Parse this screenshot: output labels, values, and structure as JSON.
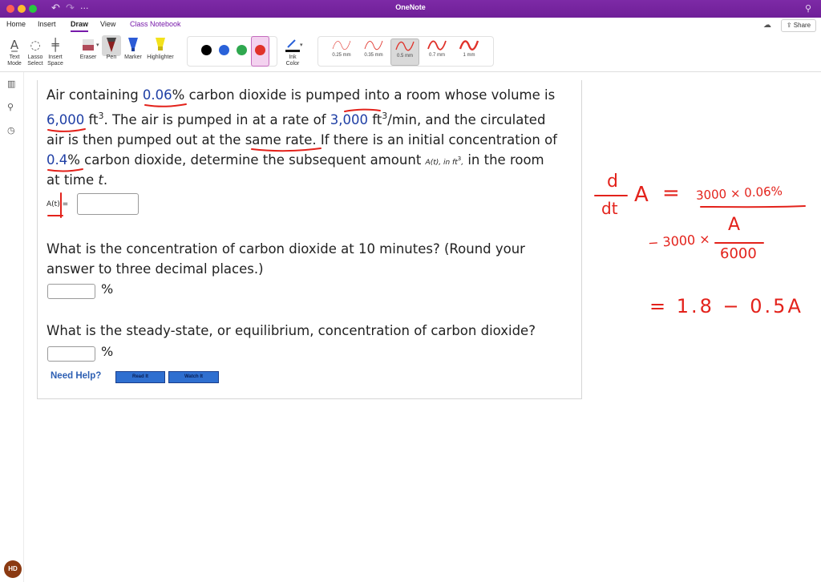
{
  "window": {
    "title": "OneNote"
  },
  "tabs": [
    {
      "label": "Home"
    },
    {
      "label": "Insert"
    },
    {
      "label": "Draw"
    },
    {
      "label": "View"
    },
    {
      "label": "Class Notebook"
    }
  ],
  "share_label": "Share",
  "ribbon": {
    "text_mode": "Text\nMode",
    "lasso_select": "Lasso\nSelect",
    "insert_space": "Insert\nSpace",
    "eraser": "Eraser",
    "pen": "Pen",
    "marker": "Marker",
    "highlighter": "Highlighter",
    "ink_color": "Ink\nColor",
    "colors": [
      "#000000",
      "#2a62d9",
      "#2fa84f",
      "#e0322a"
    ],
    "thicknesses": [
      "0.25 mm",
      "0.35 mm",
      "0.5 mm",
      "0.7 mm",
      "1 mm"
    ],
    "selected_thickness": "0.5 mm"
  },
  "problem": {
    "line1_a": "Air containing ",
    "line1_b": "0.06",
    "line1_c": "% carbon dioxide is pumped into a room whose volume is",
    "line2_a": "6,000",
    "line2_b": " ft",
    "line2_exp": "3",
    "line2_c": ". The air is pumped in at a rate of ",
    "line2_d": "3,000",
    "line2_e": " ft",
    "line2_f": "/min, and the circulated",
    "line3": "air is then pumped out at the same rate. If there is an initial concentration of",
    "line4_a": "0.4",
    "line4_b": "% carbon dioxide, determine the subsequent amount ",
    "line4_math": "A(t), in ft",
    "line4_math_end": ",",
    "line4_c": " in the room",
    "line5_a": "at time ",
    "line5_b": "t",
    "line5_c": ".",
    "at_label": "A(t) =",
    "q2_line1": "What is the concentration of carbon dioxide at 10 minutes? (Round your",
    "q2_line2": "answer to three decimal places.)",
    "q3": "What is the steady-state, or equilibrium, concentration of carbon dioxide?",
    "percent": "%",
    "need_help": "Need Help?",
    "read_it": "Read It",
    "watch_it": "Watch It"
  },
  "handwriting": {
    "d": "d",
    "dt": "dt",
    "A": "A",
    "eq1_rhs": "3000 × 0.06%",
    "minus_term": "− 3000 ×",
    "frac_num": "A",
    "frac_den": "6000",
    "eq2": "= 1.8 − 0.5A",
    "equals": "="
  },
  "user": {
    "initials": "HD"
  }
}
